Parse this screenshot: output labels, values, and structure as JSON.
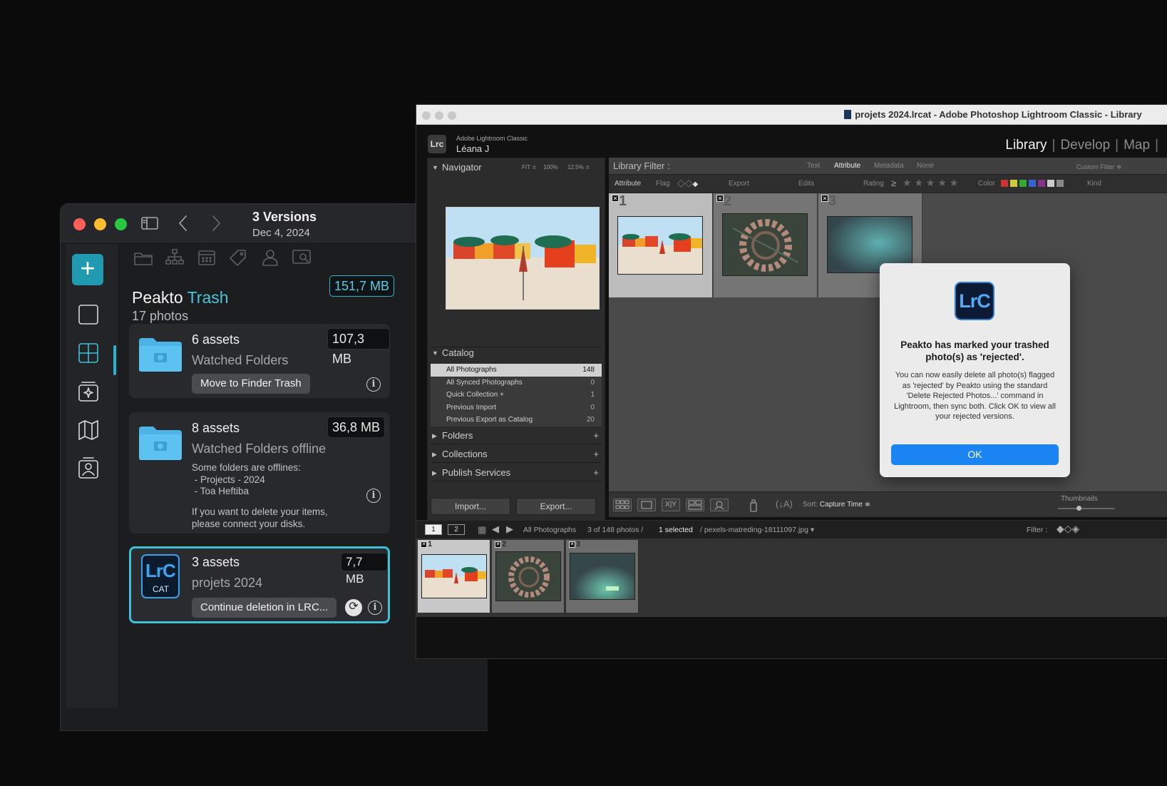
{
  "peakto": {
    "title": "3 Versions",
    "date": "Dec 4, 2024",
    "add_label": "+",
    "trash": {
      "name": "Peakto",
      "accent": "Trash",
      "count": "17 photos",
      "size": "151,7 MB"
    },
    "cards": [
      {
        "assets": "6 assets",
        "desc": "Watched Folders",
        "size": "107,3 MB",
        "button": "Move to Finder Trash"
      },
      {
        "assets": "8 assets",
        "desc": "Watched Folders offline",
        "size": "36,8 MB",
        "note1": "Some folders are offlines:\n - Projects - 2024\n - Toa Heftiba",
        "note2": "If you want to delete your items,\nplease connect your disks."
      },
      {
        "assets": "3 assets",
        "desc": "projets 2024",
        "size": "7,7 MB",
        "button": "Continue deletion in LRC...",
        "icon_title": "LrC",
        "icon_sub": "CAT"
      }
    ],
    "colors": {
      "accent": "#2ab4cc",
      "folder": "#4cb3e6"
    }
  },
  "lr": {
    "title": "projets 2024.lrcat - Adobe Photoshop Lightroom Classic - Library",
    "identity": {
      "plate": "Lrc",
      "app": "Adobe Lightroom Classic",
      "user": "Léana J"
    },
    "modules": [
      "Library",
      "Develop",
      "Map"
    ],
    "navigator": {
      "label": "Navigator",
      "zooms": [
        "FIT ≑",
        "100%",
        "12.5% ≑"
      ]
    },
    "catalog": {
      "label": "Catalog",
      "items": [
        {
          "name": "All Photographs",
          "count": "148"
        },
        {
          "name": "All Synced Photographs",
          "count": "0"
        },
        {
          "name": "Quick Collection  +",
          "count": "1"
        },
        {
          "name": "Previous Import",
          "count": "0"
        },
        {
          "name": "Previous Export as Catalog",
          "count": "20"
        }
      ]
    },
    "panels": {
      "folders": "Folders",
      "collections": "Collections",
      "publish": "Publish Services"
    },
    "buttons": {
      "import": "Import...",
      "export": "Export..."
    },
    "filter": {
      "label": "Library Filter :",
      "text": "Text",
      "attribute": "Attribute",
      "metadata": "Metadata",
      "none": "None",
      "custom": "Custom Filter ≑"
    },
    "attr_bar": {
      "attribute": "Attribute",
      "flag": "Flag",
      "export": "Export",
      "edits": "Edits",
      "rating": "Rating",
      "ge": "≥",
      "color": "Color",
      "kind": "Kind",
      "stars": "★ ★ ★ ★ ★"
    },
    "grid_numbers": [
      "1",
      "2",
      "3"
    ],
    "toolbar": {
      "sort_label": "Sort:",
      "sort_value": "Capture Time ≑",
      "thumbs": "Thumbnails"
    },
    "filmstrip_bar": {
      "page1": "1",
      "page2": "2",
      "source": "All Photographs",
      "count": "3 of 148 photos /",
      "selected": "1 selected",
      "file": "/ pexels-matreding-18111097.jpg ▾",
      "filter": "Filter :"
    },
    "dialog": {
      "icon": "LrC",
      "title": "Peakto has marked your trashed photo(s) as 'rejected'.",
      "body": "You can now easily delete all photo(s) flagged as 'rejected' by Peakto using the standard 'Delete Rejected Photos...' command in Lightroom, then sync both. Click OK to view all your rejected versions.",
      "ok": "OK"
    }
  }
}
